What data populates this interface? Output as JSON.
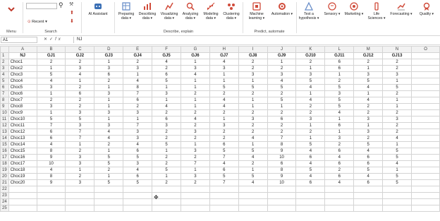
{
  "ribbon": {
    "menu_label": "Menu",
    "search_label": "Search",
    "search_input_value": "",
    "recent_label": "Recent",
    "ai_assistant_label": "AI Assistant",
    "describe_group_label": "Describe, explain",
    "predict_group_label": "Predict, automate",
    "buttons": [
      {
        "label": "Preparing data",
        "color": "#6a8fc9"
      },
      {
        "label": "Describing data",
        "color": "#d04b3a"
      },
      {
        "label": "Visualizing data",
        "color": "#d04b3a"
      },
      {
        "label": "Analyzing data",
        "color": "#d04b3a"
      },
      {
        "label": "Modeling data",
        "color": "#d04b3a"
      },
      {
        "label": "Clustering data",
        "color": "#d04b3a"
      },
      {
        "label": "Machine learning",
        "color": "#d04b3a"
      },
      {
        "label": "Automation",
        "color": "#d04b3a"
      },
      {
        "label": "Test a hypothesis",
        "color": "#6a8fc9"
      },
      {
        "label": "Sensory",
        "color": "#d04b3a"
      },
      {
        "label": "Marketing",
        "color": "#d04b3a"
      },
      {
        "label": "Life Sciences",
        "color": "#d04b3a"
      },
      {
        "label": "Forecasting",
        "color": "#d04b3a"
      },
      {
        "label": "Quality",
        "color": "#d04b3a"
      }
    ]
  },
  "formula_bar": {
    "name_box": "A1",
    "fx": "fx",
    "content": "NJ"
  },
  "columns": [
    "A",
    "B",
    "C",
    "D",
    "E",
    "F",
    "G",
    "H",
    "I",
    "J",
    "K",
    "L",
    "M",
    "N",
    "O"
  ],
  "header_row": [
    "NJ",
    "GJ1",
    "GJ2",
    "GJ3",
    "GJ4",
    "GJ5",
    "GJ6",
    "GJ7",
    "GJ8",
    "GJ9",
    "GJ10",
    "GJ11",
    "GJ12",
    "GJ13"
  ],
  "rows": [
    [
      "Choc1",
      "2",
      "2",
      "1",
      "2",
      "4",
      "1",
      "4",
      "2",
      "1",
      "2",
      "6",
      "2",
      "2"
    ],
    [
      "Choc2",
      "1",
      "3",
      "3",
      "3",
      "2",
      "3",
      "3",
      "2",
      "2",
      "1",
      "6",
      "1",
      "2"
    ],
    [
      "Choc3",
      "5",
      "4",
      "6",
      "1",
      "6",
      "4",
      "1",
      "3",
      "3",
      "3",
      "1",
      "3",
      "3"
    ],
    [
      "Choc4",
      "4",
      "1",
      "2",
      "4",
      "5",
      "1",
      "1",
      "1",
      "4",
      "5",
      "2",
      "5",
      "1"
    ],
    [
      "Choc5",
      "3",
      "2",
      "1",
      "8",
      "1",
      "1",
      "5",
      "5",
      "5",
      "4",
      "5",
      "4",
      "5"
    ],
    [
      "Choc6",
      "1",
      "6",
      "3",
      "7",
      "3",
      "2",
      "2",
      "2",
      "2",
      "1",
      "3",
      "1",
      "2"
    ],
    [
      "Choc7",
      "2",
      "2",
      "1",
      "6",
      "1",
      "1",
      "4",
      "1",
      "5",
      "4",
      "5",
      "4",
      "1"
    ],
    [
      "Choc8",
      "3",
      "2",
      "1",
      "2",
      "4",
      "1",
      "4",
      "1",
      "1",
      "2",
      "5",
      "2",
      "1"
    ],
    [
      "Choc9",
      "1",
      "3",
      "3",
      "3",
      "2",
      "2",
      "2",
      "2",
      "2",
      "2",
      "4",
      "2",
      "2"
    ],
    [
      "Choc10",
      "5",
      "5",
      "1",
      "1",
      "6",
      "4",
      "1",
      "3",
      "6",
      "3",
      "1",
      "3",
      "3"
    ],
    [
      "Choc11",
      "7",
      "3",
      "3",
      "7",
      "3",
      "2",
      "3",
      "2",
      "2",
      "1",
      "6",
      "1",
      "2"
    ],
    [
      "Choc12",
      "6",
      "7",
      "4",
      "3",
      "2",
      "3",
      "2",
      "2",
      "2",
      "2",
      "1",
      "3",
      "2"
    ],
    [
      "Choc13",
      "6",
      "7",
      "4",
      "3",
      "2",
      "2",
      "2",
      "4",
      "7",
      "1",
      "3",
      "2",
      "4"
    ],
    [
      "Choc14",
      "4",
      "1",
      "2",
      "4",
      "5",
      "1",
      "6",
      "1",
      "8",
      "5",
      "2",
      "5",
      "1"
    ],
    [
      "Choc15",
      "8",
      "2",
      "1",
      "6",
      "1",
      "3",
      "5",
      "5",
      "9",
      "4",
      "6",
      "4",
      "5"
    ],
    [
      "Choc16",
      "9",
      "3",
      "5",
      "5",
      "2",
      "2",
      "7",
      "4",
      "10",
      "6",
      "4",
      "6",
      "5"
    ],
    [
      "Choc17",
      "10",
      "3",
      "5",
      "3",
      "2",
      "7",
      "4",
      "2",
      "6",
      "4",
      "6",
      "6",
      "4"
    ],
    [
      "Choc18",
      "4",
      "1",
      "2",
      "4",
      "5",
      "1",
      "6",
      "1",
      "8",
      "5",
      "2",
      "5",
      "1"
    ],
    [
      "Choc19",
      "8",
      "2",
      "1",
      "6",
      "1",
      "3",
      "5",
      "5",
      "9",
      "4",
      "6",
      "4",
      "5"
    ],
    [
      "Choc20",
      "9",
      "3",
      "5",
      "5",
      "2",
      "2",
      "7",
      "4",
      "10",
      "6",
      "4",
      "6",
      "5"
    ]
  ],
  "extra_row_numbers": [
    "22",
    "23",
    "24",
    "25"
  ]
}
